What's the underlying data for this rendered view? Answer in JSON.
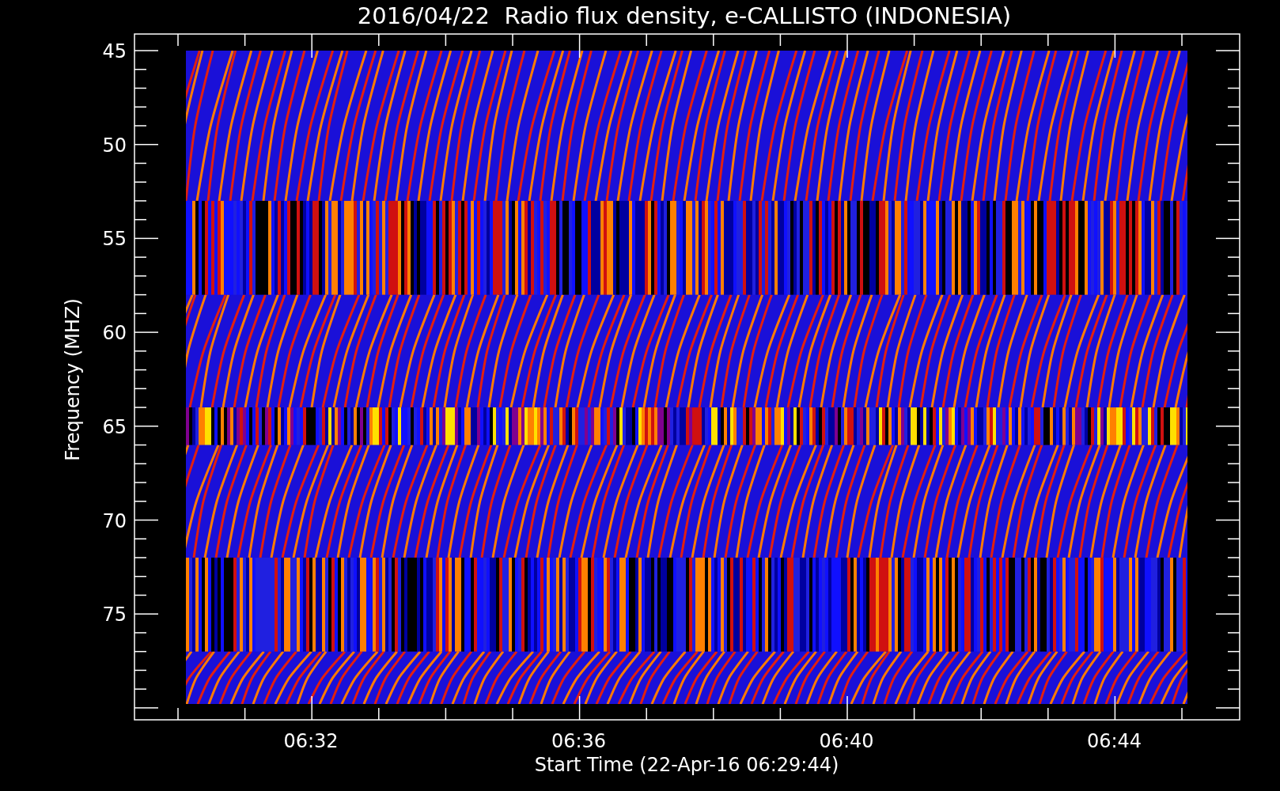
{
  "title": "2016/04/22  Radio flux density, e-CALLISTO (INDONESIA)",
  "y_axis": {
    "title": "Frequency (MHZ)",
    "ticks": [
      "45",
      "50",
      "55",
      "60",
      "65",
      "70",
      "75"
    ]
  },
  "x_axis": {
    "title": "Start Time (22-Apr-16 06:29:44)",
    "ticks": [
      "06:32",
      "06:36",
      "06:40",
      "06:44"
    ]
  }
}
